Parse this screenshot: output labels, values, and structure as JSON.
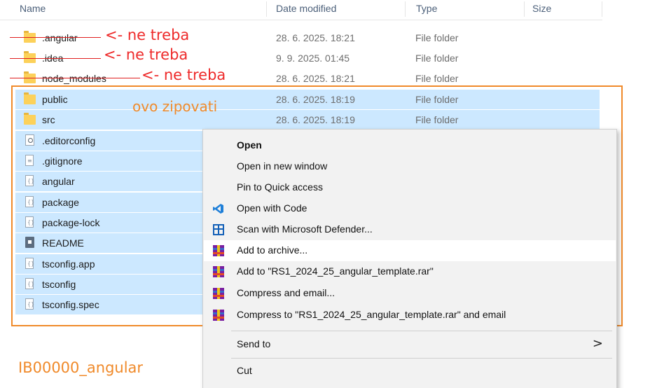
{
  "columns": {
    "name": "Name",
    "date": "Date modified",
    "type": "Type",
    "size": "Size"
  },
  "files": [
    {
      "name": ".angular",
      "date": "28. 6. 2025. 18:21",
      "type": "File folder",
      "icon": "folder-icon"
    },
    {
      "name": ".idea",
      "date": "9. 9. 2025. 01:45",
      "type": "File folder",
      "icon": "folder-icon"
    },
    {
      "name": "node_modules",
      "date": "28. 6. 2025. 18:21",
      "type": "File folder",
      "icon": "folder-icon"
    },
    {
      "name": "public",
      "date": "28. 6. 2025. 18:19",
      "type": "File folder",
      "icon": "folder-icon"
    },
    {
      "name": "src",
      "date": "28. 6. 2025. 18:19",
      "type": "File folder",
      "icon": "folder-icon"
    },
    {
      "name": ".editorconfig",
      "icon": "config-file-icon"
    },
    {
      "name": ".gitignore",
      "icon": "text-file-icon"
    },
    {
      "name": "angular",
      "icon": "json-file-icon"
    },
    {
      "name": "package",
      "icon": "json-file-icon"
    },
    {
      "name": "package-lock",
      "icon": "json-file-icon"
    },
    {
      "name": "README",
      "icon": "markdown-file-icon"
    },
    {
      "name": "tsconfig.app",
      "icon": "json-file-icon"
    },
    {
      "name": "tsconfig",
      "icon": "json-file-icon"
    },
    {
      "name": "tsconfig.spec",
      "icon": "json-file-icon"
    }
  ],
  "annotations": {
    "ne_treba_1": "<- ne treba",
    "ne_treba_2": "<- ne treba",
    "ne_treba_3": "<- ne treba",
    "zip_note": "ovo zipovati",
    "archive_name": "IB00000_angular",
    "colors": {
      "strike": "#e02020",
      "highlight": "#f08a2a"
    }
  },
  "context_menu": {
    "items": [
      {
        "label": "Open",
        "bold": true
      },
      {
        "label": "Open in new window"
      },
      {
        "label": "Pin to Quick access"
      },
      {
        "label": "Open with Code",
        "icon": "vscode-icon"
      },
      {
        "label": "Scan with Microsoft Defender...",
        "icon": "defender-icon"
      },
      {
        "label": "Add to archive...",
        "icon": "winrar-icon",
        "hover": true
      },
      {
        "label": "Add to \"RS1_2024_25_angular_template.rar\"",
        "icon": "winrar-icon"
      },
      {
        "label": "Compress and email...",
        "icon": "winrar-icon"
      },
      {
        "label": "Compress to \"RS1_2024_25_angular_template.rar\" and email",
        "icon": "winrar-icon"
      },
      {
        "label": "Send to",
        "submenu": true
      },
      {
        "label": "Cut"
      }
    ],
    "submenu_glyph": ">"
  },
  "colors": {
    "selection": "#cce8ff",
    "menu_bg": "#f2f2f2",
    "folder": "#fcd15a"
  }
}
